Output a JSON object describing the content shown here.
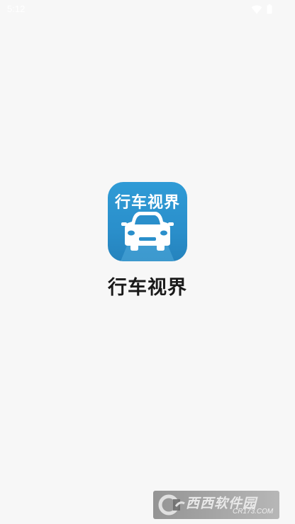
{
  "status_bar": {
    "time": "5:12",
    "icons": [
      "wifi-icon",
      "battery-icon"
    ]
  },
  "splash": {
    "icon_text": "行车视界",
    "app_name": "行车视界",
    "brand_color": "#2a8fcb"
  },
  "watermark": {
    "brand": "西西软件园",
    "url": "CR173.COM"
  }
}
